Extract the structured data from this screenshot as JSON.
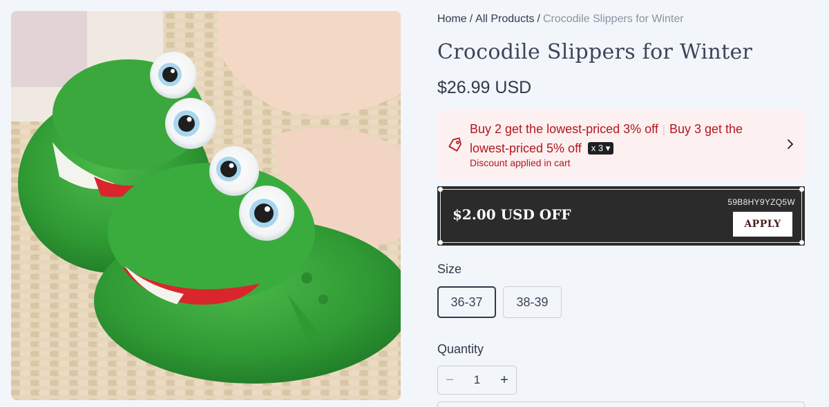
{
  "breadcrumb": {
    "home": "Home",
    "all_products": "All Products",
    "separator": "/",
    "current": "Crocodile Slippers for Winter"
  },
  "product": {
    "title": "Crocodile Slippers for Winter",
    "price": "$26.99 USD",
    "image_alt": "Green plush crocodile slippers"
  },
  "promo": {
    "offer_1": "Buy 2 get the lowest-priced 3% off",
    "divider": "|",
    "offer_2_a": "Buy 3 get the",
    "offer_2_b": "lowest-priced 5% off",
    "badge": "x 3",
    "subtext": "Discount applied in cart",
    "icon": "tag-icon",
    "chevron_icon": "chevron-right-icon",
    "color": "#b4161f"
  },
  "coupon": {
    "amount": "$2.00 USD OFF",
    "code": "59B8HY9YZQ5W",
    "apply_label": "APPLY"
  },
  "size": {
    "label": "Size",
    "options": [
      "36-37",
      "38-39"
    ],
    "selected": "36-37"
  },
  "quantity": {
    "label": "Quantity",
    "value": "1",
    "minus": "−",
    "plus": "+"
  },
  "colors": {
    "background": "#f2f5fa",
    "text": "#2f3a4a",
    "promo_bg": "#fcf0f0",
    "coupon_bg": "#2b2b2b"
  }
}
